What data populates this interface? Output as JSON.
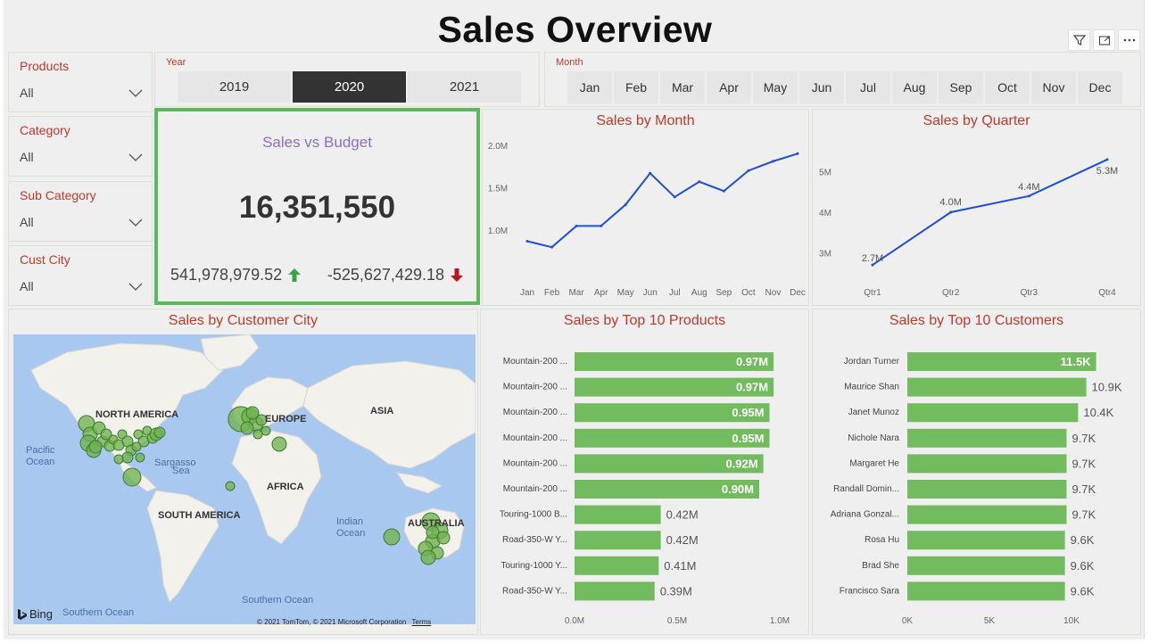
{
  "title": "Sales Overview",
  "toolbar": {
    "icons": [
      "filter-icon",
      "expand-icon",
      "more-icon"
    ]
  },
  "slicers": [
    {
      "label": "Products",
      "value": "All"
    },
    {
      "label": "Category",
      "value": "All"
    },
    {
      "label": "Sub Category",
      "value": "All"
    },
    {
      "label": "Cust City",
      "value": "All"
    }
  ],
  "year_slicer": {
    "label": "Year",
    "options": [
      "2019",
      "2020",
      "2021"
    ],
    "selected": "2020"
  },
  "month_slicer": {
    "label": "Month",
    "options": [
      "Jan",
      "Feb",
      "Mar",
      "Apr",
      "May",
      "Jun",
      "Jul",
      "Aug",
      "Sep",
      "Oct",
      "Nov",
      "Dec"
    ]
  },
  "kpi": {
    "title": "Sales vs Budget",
    "value": "16,351,550",
    "left": "541,978,979.52",
    "right": "-525,627,429.18"
  },
  "colors": {
    "accent_red": "#c0392b",
    "line_blue": "#1f4fd1",
    "bar_green": "#72bb5e",
    "kpi_border": "#5cb85c",
    "up_green": "#3aa34a",
    "down_red": "#c0121c"
  },
  "map": {
    "title": "Sales by Customer City",
    "labels": {
      "north_america": "NORTH AMERICA",
      "europe": "EUROPE",
      "asia": "ASIA",
      "africa": "AFRICA",
      "south_america": "SOUTH AMERICA",
      "australia": "AUSTRALIA",
      "pacific_1": "Pacific",
      "pacific_2": "Ocean",
      "sargasso_1": "Sargasso",
      "sargasso_2": "Sea",
      "indian_1": "Indian",
      "indian_2": "Ocean",
      "southern": "Southern Ocean",
      "southern2": "Southern Ocean"
    },
    "bing": "Bing",
    "attribution": "© 2021 TomTom, © 2021 Microsoft Corporation",
    "terms": "Terms"
  },
  "chart_data": [
    {
      "type": "line",
      "title": "Sales by Month",
      "x": [
        "Jan",
        "Feb",
        "Mar",
        "Apr",
        "May",
        "Jun",
        "Jul",
        "Aug",
        "Sep",
        "Oct",
        "Nov",
        "Dec"
      ],
      "values": [
        0.87,
        0.8,
        1.05,
        1.05,
        1.3,
        1.67,
        1.39,
        1.57,
        1.46,
        1.7,
        1.81,
        1.9
      ],
      "yticks": [
        "1.0M",
        "1.5M",
        "2.0M"
      ],
      "ytick_values": [
        1.0,
        1.5,
        2.0
      ],
      "ylim": [
        0.55,
        2.05
      ]
    },
    {
      "type": "line",
      "title": "Sales by Quarter",
      "x": [
        "Qtr1",
        "Qtr2",
        "Qtr3",
        "Qtr4"
      ],
      "values": [
        2.7,
        4.0,
        4.4,
        5.3
      ],
      "data_labels": [
        "2.7M",
        "4.0M",
        "4.4M",
        "5.3M"
      ],
      "yticks": [
        "3M",
        "4M",
        "5M"
      ],
      "ytick_values": [
        3,
        4,
        5
      ],
      "ylim": [
        2.35,
        5.65
      ]
    },
    {
      "type": "bar",
      "title": "Sales by Top 10 Products",
      "categories": [
        "Mountain-200 ...",
        "Mountain-200 ...",
        "Mountain-200 ...",
        "Mountain-200 ...",
        "Mountain-200 ...",
        "Mountain-200 ...",
        "Touring-1000 B...",
        "Road-350-W Y...",
        "Touring-1000 Y...",
        "Road-350-W Y..."
      ],
      "values": [
        0.97,
        0.97,
        0.95,
        0.95,
        0.92,
        0.9,
        0.42,
        0.42,
        0.41,
        0.39
      ],
      "data_labels": [
        "0.97M",
        "0.97M",
        "0.95M",
        "0.95M",
        "0.92M",
        "0.90M",
        "0.42M",
        "0.42M",
        "0.41M",
        "0.39M"
      ],
      "xticks": [
        "0.0M",
        "0.5M",
        "1.0M"
      ],
      "xtick_values": [
        0,
        0.5,
        1.0
      ],
      "xlim": [
        0,
        1.0
      ]
    },
    {
      "type": "bar",
      "title": "Sales by Top 10 Customers",
      "categories": [
        "Jordan Turner",
        "Maurice Shan",
        "Janet Munoz",
        "Nichole Nara",
        "Margaret He",
        "Randall Domin...",
        "Adriana Gonzal...",
        "Rosa Hu",
        "Brad She",
        "Francisco Sara"
      ],
      "values": [
        11.5,
        10.9,
        10.4,
        9.7,
        9.7,
        9.7,
        9.7,
        9.6,
        9.6,
        9.6
      ],
      "data_labels": [
        "11.5K",
        "10.9K",
        "10.4K",
        "9.7K",
        "9.7K",
        "9.7K",
        "9.7K",
        "9.6K",
        "9.6K",
        "9.6K"
      ],
      "xticks": [
        "0K",
        "5K",
        "10K"
      ],
      "xtick_values": [
        0,
        5,
        10
      ],
      "xlim": [
        0,
        10
      ]
    }
  ]
}
